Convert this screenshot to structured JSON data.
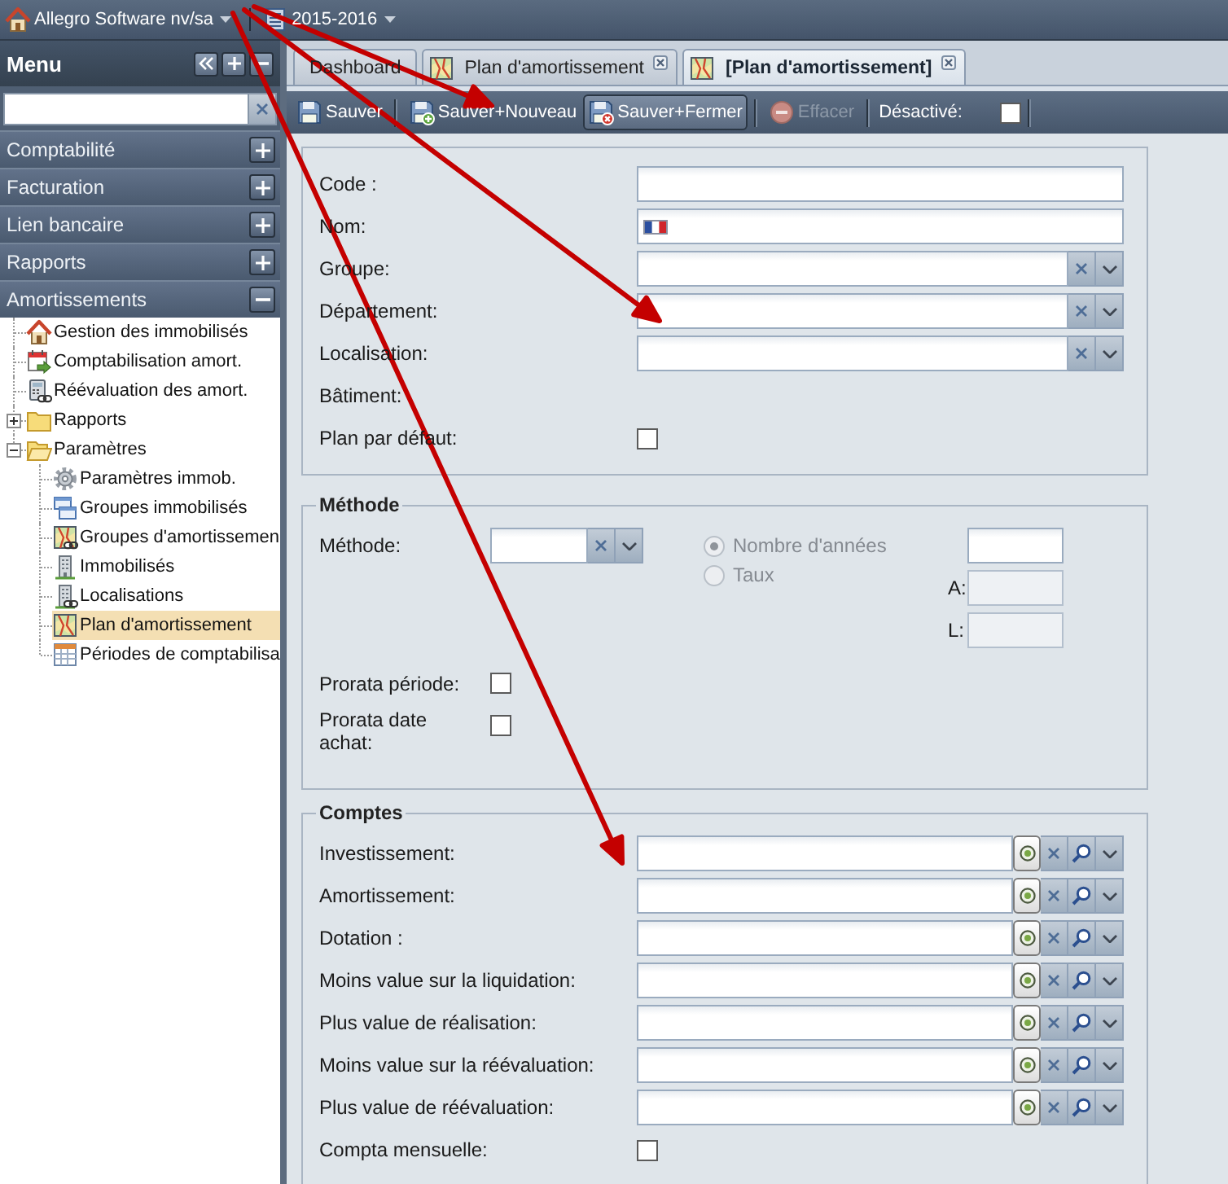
{
  "top_bar": {
    "company": "Allegro Software nv/sa",
    "fiscal_year": "2015-2016"
  },
  "menu": {
    "title": "Menu",
    "sections": [
      {
        "label": "Comptabilité",
        "expanded": false
      },
      {
        "label": "Facturation",
        "expanded": false
      },
      {
        "label": "Lien bancaire",
        "expanded": false
      },
      {
        "label": "Rapports",
        "expanded": false
      },
      {
        "label": "Amortissements",
        "expanded": true
      }
    ],
    "tree": [
      {
        "label": "Gestion des immobilisés",
        "kind": "house",
        "selected": false
      },
      {
        "label": "Comptabilisation amort.",
        "kind": "calendar",
        "selected": false
      },
      {
        "label": "Réévaluation des amort.",
        "kind": "calculator",
        "selected": false
      },
      {
        "label": "Rapports",
        "kind": "folder",
        "selected": false,
        "expanded": false
      },
      {
        "label": "Paramètres",
        "kind": "folder",
        "selected": false,
        "expanded": true,
        "children": [
          {
            "label": "Paramètres immob.",
            "kind": "gear",
            "selected": false
          },
          {
            "label": "Groupes immobilisés",
            "kind": "windows",
            "selected": false
          },
          {
            "label": "Groupes d'amortissemen",
            "kind": "map_link",
            "selected": false
          },
          {
            "label": "Immobilisés",
            "kind": "building",
            "selected": false
          },
          {
            "label": "Localisations",
            "kind": "building_link",
            "selected": false
          },
          {
            "label": "Plan d'amortissement",
            "kind": "map",
            "selected": true
          },
          {
            "label": "Périodes de comptabilisa",
            "kind": "table",
            "selected": false
          }
        ]
      }
    ]
  },
  "tabs": [
    {
      "label": "Dashboard",
      "kind": "plain",
      "closable": false,
      "selected": false
    },
    {
      "label": "Plan d'amortissement",
      "kind": "map",
      "closable": true,
      "selected": false
    },
    {
      "label": "[Plan d'amortissement]",
      "kind": "map",
      "closable": true,
      "selected": true
    }
  ],
  "toolbar": [
    {
      "kind": "save",
      "label": "Sauver",
      "pressed": false,
      "disabled": false
    },
    {
      "kind": "separator"
    },
    {
      "kind": "save_new",
      "label": "Sauver+Nouveau",
      "pressed": false,
      "disabled": false
    },
    {
      "kind": "save_close",
      "label": "Sauver+Fermer",
      "pressed": true,
      "disabled": false
    },
    {
      "kind": "separator"
    },
    {
      "kind": "delete",
      "label": "Effacer",
      "pressed": false,
      "disabled": true
    },
    {
      "kind": "separator"
    },
    {
      "kind": "checkbox",
      "label": "Désactivé:",
      "checked": false
    },
    {
      "kind": "separator"
    }
  ],
  "general": {
    "fields": [
      {
        "kind": "text",
        "label": "Code :"
      },
      {
        "kind": "translatable",
        "label": "Nom:"
      },
      {
        "kind": "combo",
        "label": "Groupe:"
      },
      {
        "kind": "combo",
        "label": "Département:"
      },
      {
        "kind": "combo",
        "label": "Localisation:"
      },
      {
        "kind": "static",
        "label": "Bâtiment:"
      },
      {
        "kind": "checkbox",
        "label": "Plan par défaut:",
        "checked": false
      }
    ]
  },
  "methode": {
    "legend": "Méthode",
    "method_label": "Méthode:",
    "options_disabled": true,
    "options": [
      {
        "label": "Nombre d'années",
        "selected": true
      },
      {
        "label": "Taux",
        "selected": false
      }
    ],
    "rate_fields": [
      {
        "disabled": false
      },
      {
        "label": "A:",
        "disabled": true
      },
      {
        "label": "L:",
        "disabled": true
      }
    ],
    "checks": [
      {
        "label": "Prorata période:",
        "checked": false
      },
      {
        "label": "Prorata date achat:",
        "checked": false
      }
    ]
  },
  "comptes": {
    "legend": "Comptes",
    "fields": [
      {
        "kind": "account",
        "label": "Investissement:"
      },
      {
        "kind": "account",
        "label": "Amortissement:"
      },
      {
        "kind": "account",
        "label": "Dotation :"
      },
      {
        "kind": "account",
        "label": "Moins value sur la liquidation:"
      },
      {
        "kind": "account",
        "label": "Plus value de réalisation:"
      },
      {
        "kind": "account",
        "label": "Moins value sur la réévaluation:"
      },
      {
        "kind": "account",
        "label": "Plus value de réévaluation:"
      },
      {
        "kind": "checkbox",
        "label": "Compta mensuelle:",
        "checked": false
      }
    ]
  },
  "annotations": [
    {
      "kind": "arrow"
    },
    {
      "kind": "arrow"
    },
    {
      "kind": "arrow"
    }
  ]
}
